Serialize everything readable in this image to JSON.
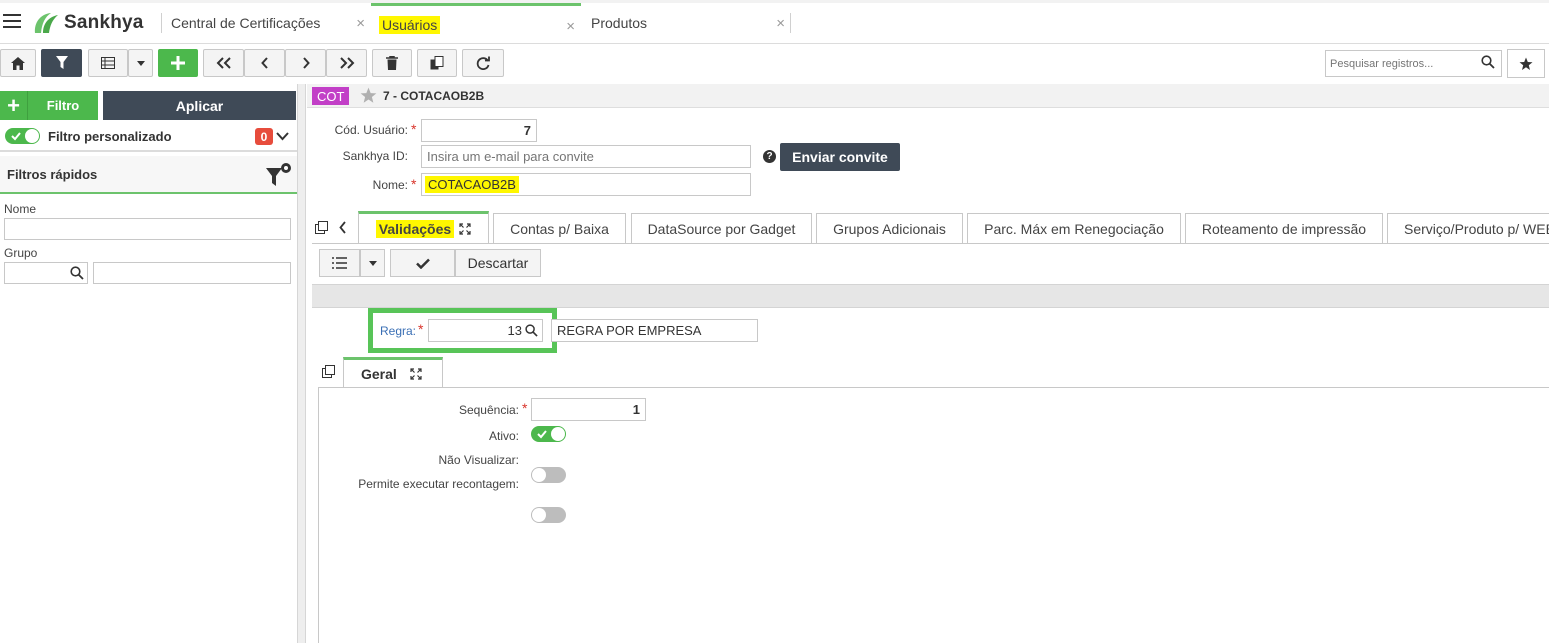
{
  "app": {
    "brand": "Sankhya"
  },
  "tabs": [
    {
      "label": "Central de Certificações",
      "close": "×"
    },
    {
      "label": "Usuários",
      "close": "×"
    },
    {
      "label": "Produtos",
      "close": "×"
    }
  ],
  "toolbar": {
    "search_placeholder": "Pesquisar registros..."
  },
  "left": {
    "filtro_label": "Filtro",
    "aplicar_label": "Aplicar",
    "filtro_personalizado": "Filtro personalizado",
    "filtro_count": "0",
    "filtros_rapidos": "Filtros rápidos",
    "nome_label": "Nome",
    "grupo_label": "Grupo"
  },
  "record": {
    "badge": "COT",
    "title": "7 - COTACAOB2B",
    "cod_usuario_label": "Cód. Usuário:",
    "cod_usuario": "7",
    "sankhya_id_label": "Sankhya ID:",
    "sankhya_id_placeholder": "Insira um e-mail para convite",
    "nome_label": "Nome:",
    "nome": "COTACAOB2B",
    "enviar_convite": "Enviar convite",
    "help": "?"
  },
  "detail_tabs": [
    {
      "label": "Validações"
    },
    {
      "label": "Contas p/ Baixa"
    },
    {
      "label": "DataSource por Gadget"
    },
    {
      "label": "Grupos Adicionais"
    },
    {
      "label": "Parc. Máx em Renegociação"
    },
    {
      "label": "Roteamento de impressão"
    },
    {
      "label": "Serviço/Produto p/ WEB"
    }
  ],
  "grid": {
    "descartar": "Descartar"
  },
  "regra": {
    "label": "Regra:",
    "value": "13",
    "description": "REGRA POR EMPRESA"
  },
  "subtab": {
    "label": "Geral"
  },
  "geral": {
    "sequencia_label": "Sequência:",
    "sequencia": "1",
    "ativo_label": "Ativo:",
    "ativo": true,
    "nao_visualizar_label": "Não Visualizar:",
    "nao_visualizar": false,
    "permite_label": "Permite executar recontagem:",
    "permite": false
  },
  "colors": {
    "accent": "#4cb84c",
    "dark": "#3f4a57",
    "highlight": "#fff700",
    "badge": "#c23fc7"
  }
}
